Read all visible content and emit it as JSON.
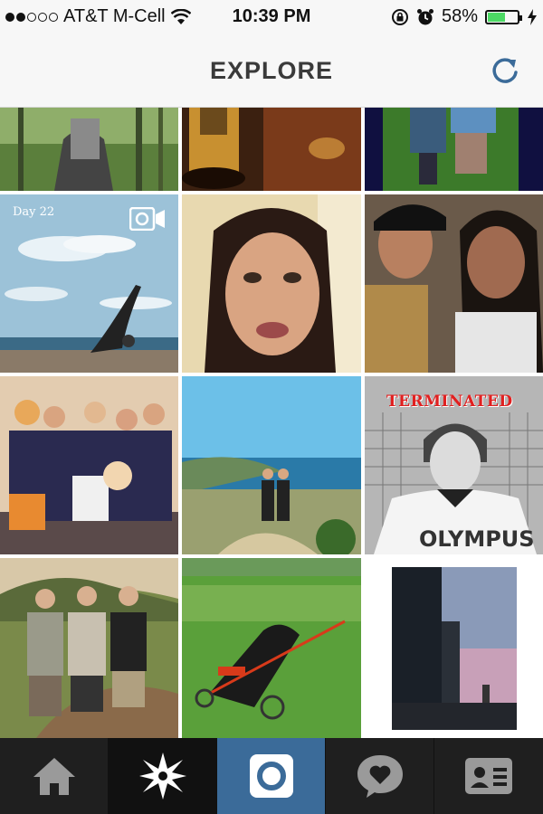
{
  "status_bar": {
    "carrier": "AT&T M-Cell",
    "time": "10:39 PM",
    "battery": "58%",
    "battery_level": 0.58,
    "signal_dots_filled": 2,
    "signal_dots_total": 5,
    "icons": [
      "wifi-icon",
      "rotation-lock-icon",
      "alarm-icon",
      "battery-icon",
      "charging-icon"
    ]
  },
  "header": {
    "title": "EXPLORE",
    "refresh_icon": "refresh-icon",
    "accent_color": "#3b6b99"
  },
  "grid": {
    "tiles": [
      {
        "name": "photo-forest-hiker"
      },
      {
        "name": "photo-beer-glass"
      },
      {
        "name": "photo-two-people-grass"
      },
      {
        "name": "photo-beach-yoga",
        "caption": "Day 22",
        "is_video": true
      },
      {
        "name": "photo-woman-face-selfie"
      },
      {
        "name": "photo-two-women-selfie"
      },
      {
        "name": "photo-cheer-team"
      },
      {
        "name": "photo-two-women-coast"
      },
      {
        "name": "photo-hockey-player",
        "banner": "TERMINATED",
        "jersey_text": "OLYMPUS"
      },
      {
        "name": "photo-three-guys-hill"
      },
      {
        "name": "photo-golf-bag"
      },
      {
        "name": "photo-city-sunset"
      }
    ]
  },
  "tab_bar": {
    "tabs": [
      {
        "name": "home",
        "icon": "home-icon"
      },
      {
        "name": "explore",
        "icon": "explore-star-icon",
        "selected": true
      },
      {
        "name": "camera",
        "icon": "camera-icon"
      },
      {
        "name": "news",
        "icon": "activity-heart-icon"
      },
      {
        "name": "profile",
        "icon": "profile-card-icon"
      }
    ]
  }
}
